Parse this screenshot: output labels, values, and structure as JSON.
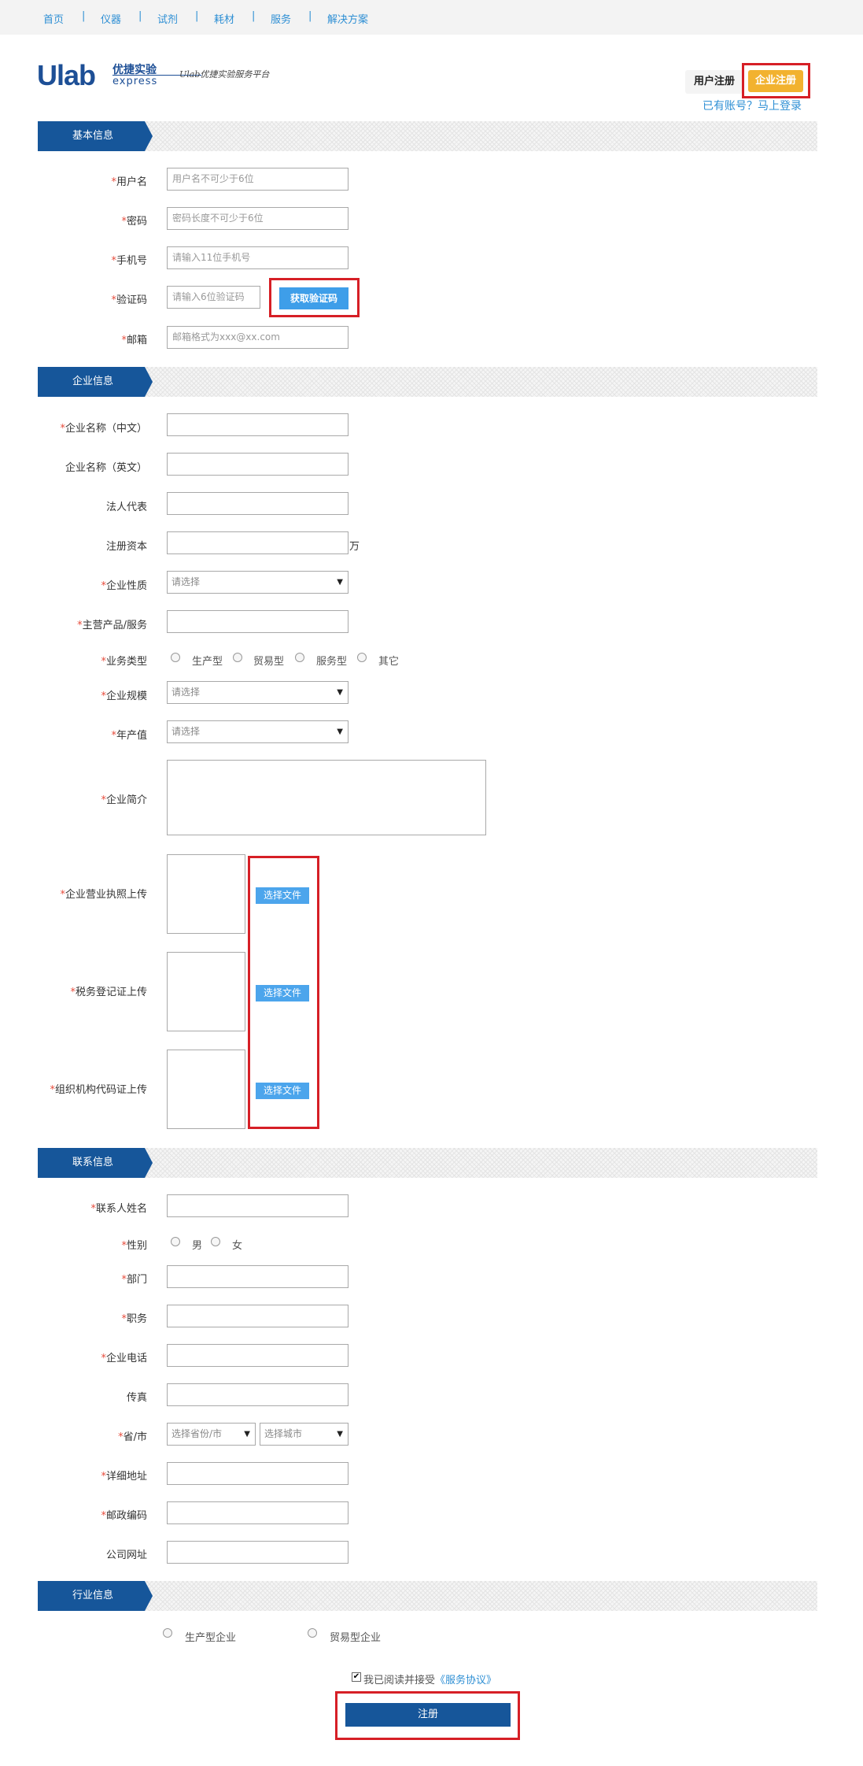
{
  "nav": {
    "items": [
      "首页",
      "仪器",
      "试剂",
      "耗材",
      "服务",
      "解决方案"
    ],
    "separator": "|"
  },
  "logo": {
    "brand": "Ulab",
    "cn": "优捷实验",
    "en": "express",
    "slogan": "Ulab优捷实验服务平台"
  },
  "header": {
    "user_register": "用户注册",
    "enterprise_register": "企业注册",
    "login_link": "已有账号？马上登录"
  },
  "colors": {
    "accent": "#16569a",
    "link": "#2e8fd4",
    "highlight": "#d61f26",
    "enterprise_btn": "#f2b22f",
    "button_blue": "#3e9ee9",
    "required": "#e74c3c"
  },
  "sections": {
    "basic": "基本信息",
    "company": "企业信息",
    "contact": "联系信息",
    "industry": "行业信息"
  },
  "required_mark": "*",
  "basic": {
    "username": {
      "label": "用户名",
      "placeholder": "用户名不可少于6位"
    },
    "password": {
      "label": "密码",
      "placeholder": "密码长度不可少于6位"
    },
    "phone": {
      "label": "手机号",
      "placeholder": "请输入11位手机号"
    },
    "code": {
      "label": "验证码",
      "placeholder": "请输入6位验证码",
      "button": "获取验证码"
    },
    "email": {
      "label": "邮箱",
      "placeholder": "邮箱格式为xxx@xx.com"
    }
  },
  "company": {
    "name_cn": "企业名称（中文）",
    "name_en": "企业名称（英文）",
    "legal_rep": "法人代表",
    "capital": "注册资本",
    "capital_unit": "万",
    "nature": {
      "label": "企业性质",
      "value": "请选择"
    },
    "main_product": "主营产品/服务",
    "business_type": {
      "label": "业务类型",
      "options": [
        "生产型",
        "贸易型",
        "服务型",
        "其它"
      ]
    },
    "scale": {
      "label": "企业规模",
      "value": "请选择"
    },
    "annual_output": {
      "label": "年产值",
      "value": "请选择"
    },
    "intro": "企业简介",
    "license_upload": "企业营业执照上传",
    "tax_upload": "税务登记证上传",
    "org_code_upload": "组织机构代码证上传",
    "choose_file": "选择文件"
  },
  "contact": {
    "name": "联系人姓名",
    "gender": {
      "label": "性别",
      "options": [
        "男",
        "女"
      ]
    },
    "department": "部门",
    "position": "职务",
    "company_phone": "企业电话",
    "fax": "传真",
    "province_city": {
      "label": "省/市",
      "province": "选择省份/市",
      "city": "选择城市"
    },
    "address": "详细地址",
    "postcode": "邮政编码",
    "website": "公司网址"
  },
  "industry": {
    "options": [
      "生产型企业",
      "贸易型企业"
    ]
  },
  "agreement": {
    "prefix": "我已阅读并接受",
    "link": "《服务协议》",
    "checked": true
  },
  "submit": "注册"
}
